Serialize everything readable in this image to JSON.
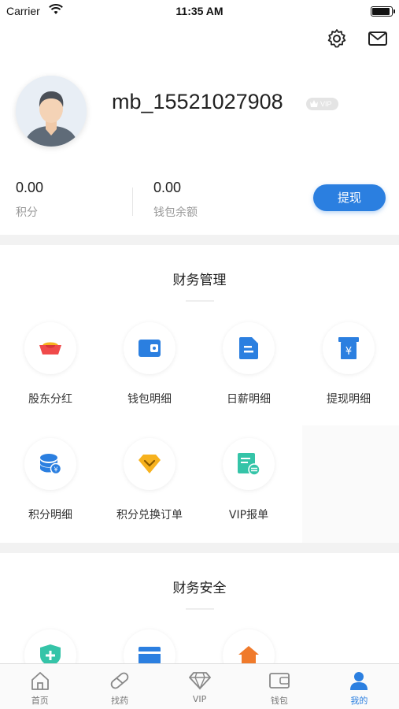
{
  "status_bar": {
    "carrier": "Carrier",
    "time": "11:35 AM"
  },
  "header": {
    "icons": [
      "settings-icon",
      "mail-icon"
    ]
  },
  "profile": {
    "username": "mb_15521027908",
    "vip_badge": "VIP",
    "points_value": "0.00",
    "points_label": "积分",
    "wallet_value": "0.00",
    "wallet_label": "钱包余额",
    "withdraw_label": "提现"
  },
  "finance_management": {
    "title": "财务管理",
    "items": [
      {
        "label": "股东分红",
        "icon": "gold-ingot-icon"
      },
      {
        "label": "钱包明细",
        "icon": "wallet-icon"
      },
      {
        "label": "日薪明细",
        "icon": "document-icon"
      },
      {
        "label": "提现明细",
        "icon": "yen-withdraw-icon"
      },
      {
        "label": "积分明细",
        "icon": "points-coins-icon"
      },
      {
        "label": "积分兑换订单",
        "icon": "diamond-exchange-icon"
      },
      {
        "label": "VIP报单",
        "icon": "vip-form-icon"
      }
    ]
  },
  "finance_security": {
    "title": "财务安全",
    "items": [
      {
        "icon": "shield-plus-icon"
      },
      {
        "icon": "card-icon"
      },
      {
        "icon": "home-icon"
      }
    ]
  },
  "tab_bar": {
    "tabs": [
      {
        "label": "首页",
        "icon": "home-tab-icon"
      },
      {
        "label": "找药",
        "icon": "pill-icon"
      },
      {
        "label": "VIP",
        "icon": "diamond-icon"
      },
      {
        "label": "钱包",
        "icon": "wallet-tab-icon"
      },
      {
        "label": "我的",
        "icon": "user-icon"
      }
    ],
    "active_index": 4
  },
  "colors": {
    "accent": "#2b7fe0",
    "red": "#f04a4a",
    "orange": "#f7b21e",
    "teal": "#35c4a8",
    "tab_active": "#2b7fe0"
  }
}
